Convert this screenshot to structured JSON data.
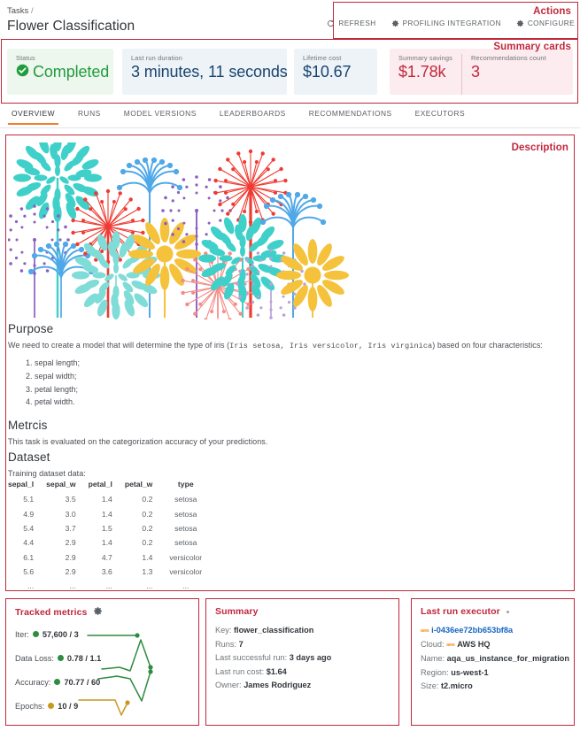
{
  "header": {
    "breadcrumb_root": "Tasks",
    "breadcrumb_sep": "/",
    "title": "Flower Classification",
    "actions_label": "Actions",
    "actions": [
      {
        "label": "REFRESH",
        "icon": "refresh-icon"
      },
      {
        "label": "PROFILING INTEGRATION",
        "icon": "gear-icon"
      },
      {
        "label": "CONFIGURE",
        "icon": "gear-icon"
      }
    ]
  },
  "summary_cards": {
    "annotation_label": "Summary cards",
    "status": {
      "label": "Status",
      "value": "Completed",
      "icon": "check-circle-icon",
      "color": "#1f9d3d"
    },
    "duration": {
      "label": "Last run duration",
      "value": "3 minutes, 11 seconds"
    },
    "cost": {
      "label": "Lifetime cost",
      "value": "$10.67"
    },
    "savings": {
      "label": "Summary savings",
      "value": "$1.78k"
    },
    "recommendations": {
      "label": "Recommendations count",
      "value": "3"
    }
  },
  "tabs": [
    {
      "label": "OVERVIEW",
      "active": true
    },
    {
      "label": "RUNS",
      "active": false
    },
    {
      "label": "MODEL VERSIONS",
      "active": false
    },
    {
      "label": "LEADERBOARDS",
      "active": false
    },
    {
      "label": "RECOMMENDATIONS",
      "active": false
    },
    {
      "label": "EXECUTORS",
      "active": false
    }
  ],
  "description": {
    "annotation_label": "Description",
    "purpose_heading": "Purpose",
    "purpose_text_before": "We need to create a model that will determine the type of iris (",
    "purpose_species": "Iris setosa, Iris versicolor, Iris virginica",
    "purpose_text_after": ") based on four characteristics:",
    "characteristics": [
      "sepal length;",
      "sepal width;",
      "petal length;",
      "petal width."
    ],
    "metrics_heading": "Metrcis",
    "metrics_text": "This task is evaluated on the categorization accuracy of your predictions.",
    "dataset_heading": "Dataset",
    "dataset_caption": "Training dataset data:",
    "dataset_columns": [
      "sepal_l",
      "sepal_w",
      "petal_l",
      "petal_w",
      "type"
    ],
    "dataset_rows": [
      [
        "5.1",
        "3.5",
        "1.4",
        "0.2",
        "setosa"
      ],
      [
        "4.9",
        "3.0",
        "1.4",
        "0.2",
        "setosa"
      ],
      [
        "5.4",
        "3.7",
        "1.5",
        "0.2",
        "setosa"
      ],
      [
        "4.4",
        "2.9",
        "1.4",
        "0.2",
        "setosa"
      ],
      [
        "6.1",
        "2.9",
        "4.7",
        "1.4",
        "versicolor"
      ],
      [
        "5.6",
        "2.9",
        "3.6",
        "1.3",
        "versicolor"
      ],
      [
        "...",
        "...",
        "...",
        "...",
        "..."
      ]
    ]
  },
  "tracked_metrics": {
    "title": "Tracked metrics",
    "settings_icon": "gear-icon",
    "rows": [
      {
        "name": "Iter:",
        "value": "57,600 / 3",
        "color": "#2e8b3f"
      },
      {
        "name": "Data Loss:",
        "value": "0.78 / 1.1",
        "color": "#2e8b3f"
      },
      {
        "name": "Accuracy:",
        "value": "70.77 / 60",
        "color": "#2e8b3f"
      },
      {
        "name": "Epochs:",
        "value": "10 / 9",
        "color": "#c9981f"
      }
    ]
  },
  "summary_panel": {
    "title": "Summary",
    "items": [
      {
        "key": "Key:",
        "value": "flower_classification"
      },
      {
        "key": "Runs:",
        "value": "7"
      },
      {
        "key": "Last successful run:",
        "value": "3 days ago"
      },
      {
        "key": "Last run cost:",
        "value": "$1.64"
      },
      {
        "key": "Owner:",
        "value": "James Rodriguez"
      }
    ]
  },
  "executor_panel": {
    "title": "Last run executor",
    "instance_id": "i-0436ee72bb653bf8a",
    "cloud_badge": "aws",
    "items": [
      {
        "key": "Cloud:",
        "value": "AWS HQ",
        "badge": "aws"
      },
      {
        "key": "Name:",
        "value": "aqa_us_instance_for_migration"
      },
      {
        "key": "Region:",
        "value": "us-west-1"
      },
      {
        "key": "Size:",
        "value": "t2.micro"
      }
    ]
  },
  "colors": {
    "accent_red": "#c0283c",
    "active_tab": "#ef7d2e",
    "green": "#1f9d3d",
    "blue_value": "#19446e"
  }
}
